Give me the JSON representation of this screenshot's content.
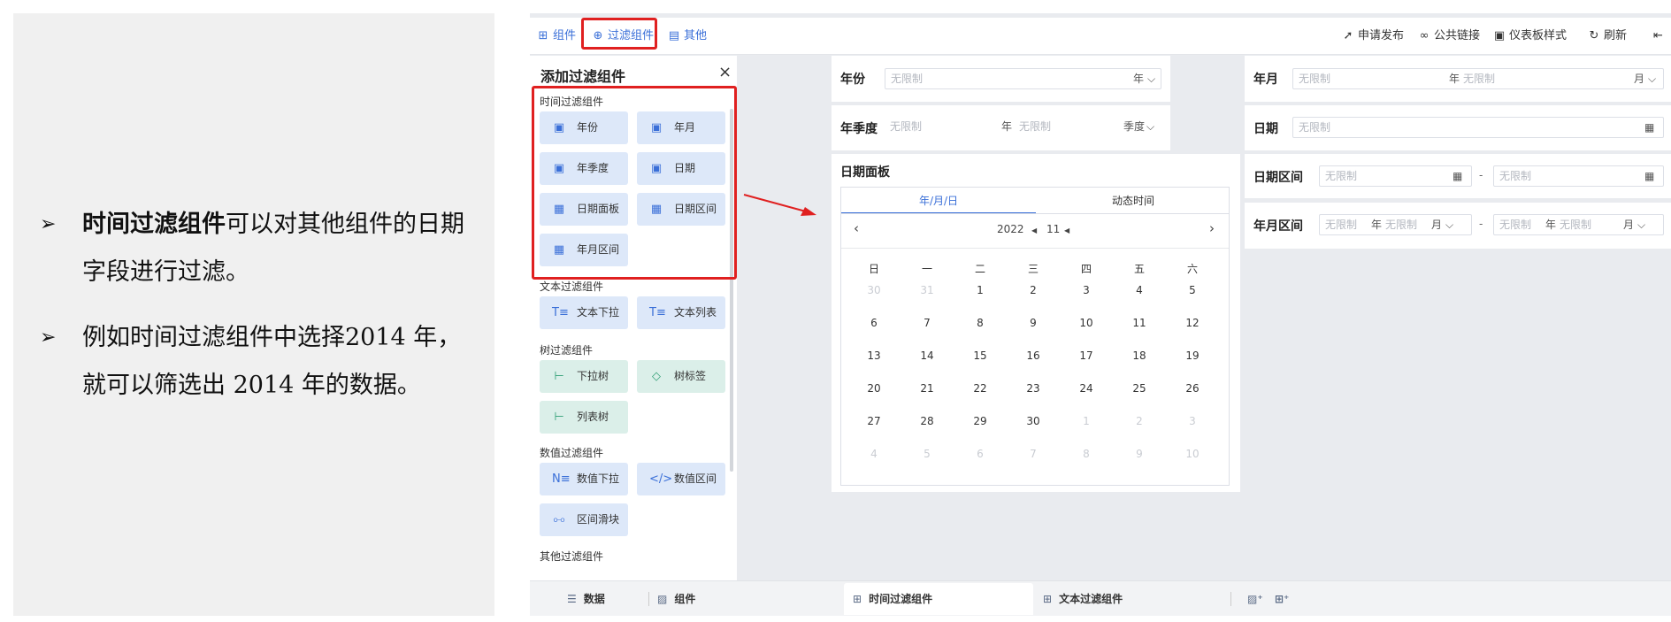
{
  "slide": {
    "bullet1_strong": "时间过滤组件",
    "bullet1_rest": "可以对其他组件的日期字段进行过滤。",
    "bullet2": "例如时间过滤组件中选择2014 年，就可以筛选出 2014 年的数据。",
    "bullet_marker": "➢"
  },
  "toolbar": {
    "component": "组件",
    "filter_component": "过滤组件",
    "other": "其他",
    "apply_publish": "申请发布",
    "public_link": "公共链接",
    "dashboard_style": "仪表板样式",
    "refresh": "刷新"
  },
  "filter_panel": {
    "title": "添加过滤组件",
    "close": "×",
    "time_section": "时间过滤组件",
    "time_items": [
      "年份",
      "年月",
      "年季度",
      "日期",
      "日期面板",
      "日期区间",
      "年月区间"
    ],
    "text_section": "文本过滤组件",
    "text_items": [
      "文本下拉",
      "文本列表"
    ],
    "tree_section": "树过滤组件",
    "tree_items": [
      "下拉树",
      "树标签",
      "列表树"
    ],
    "number_section": "数值过滤组件",
    "number_items": [
      "数值下拉",
      "数值区间",
      "区间滑块"
    ],
    "other_section": "其他过滤组件"
  },
  "widgets": {
    "year_label": "年份",
    "year_unit": "年",
    "yearmonth_label": "年月",
    "yearquarter_label": "年季度",
    "quarter_unit": "季度",
    "date_label": "日期",
    "datepanel_label": "日期面板",
    "daterange_label": "日期区间",
    "ymrange_label": "年月区间",
    "unlimited": "无限制",
    "year_u": "年",
    "month_u": "月",
    "dash": "-"
  },
  "calendar": {
    "tab_ymd": "年/月/日",
    "tab_dynamic": "动态时间",
    "year": "2022",
    "month": "11",
    "prev": "‹",
    "next": "›",
    "weekdays": [
      "日",
      "一",
      "二",
      "三",
      "四",
      "五",
      "六"
    ],
    "rows": [
      [
        "30",
        "31",
        "1",
        "2",
        "3",
        "4",
        "5"
      ],
      [
        "6",
        "7",
        "8",
        "9",
        "10",
        "11",
        "12"
      ],
      [
        "13",
        "14",
        "15",
        "16",
        "17",
        "18",
        "19"
      ],
      [
        "20",
        "21",
        "22",
        "23",
        "24",
        "25",
        "26"
      ],
      [
        "27",
        "28",
        "29",
        "30",
        "1",
        "2",
        "3"
      ],
      [
        "4",
        "5",
        "6",
        "7",
        "8",
        "9",
        "10"
      ]
    ]
  },
  "bottom_tabs": {
    "data": "数据",
    "component": "组件",
    "time_filter": "时间过滤组件",
    "text_filter": "文本过滤组件"
  },
  "colors": {
    "accent": "#3a6fd8",
    "highlight": "#e02020"
  }
}
